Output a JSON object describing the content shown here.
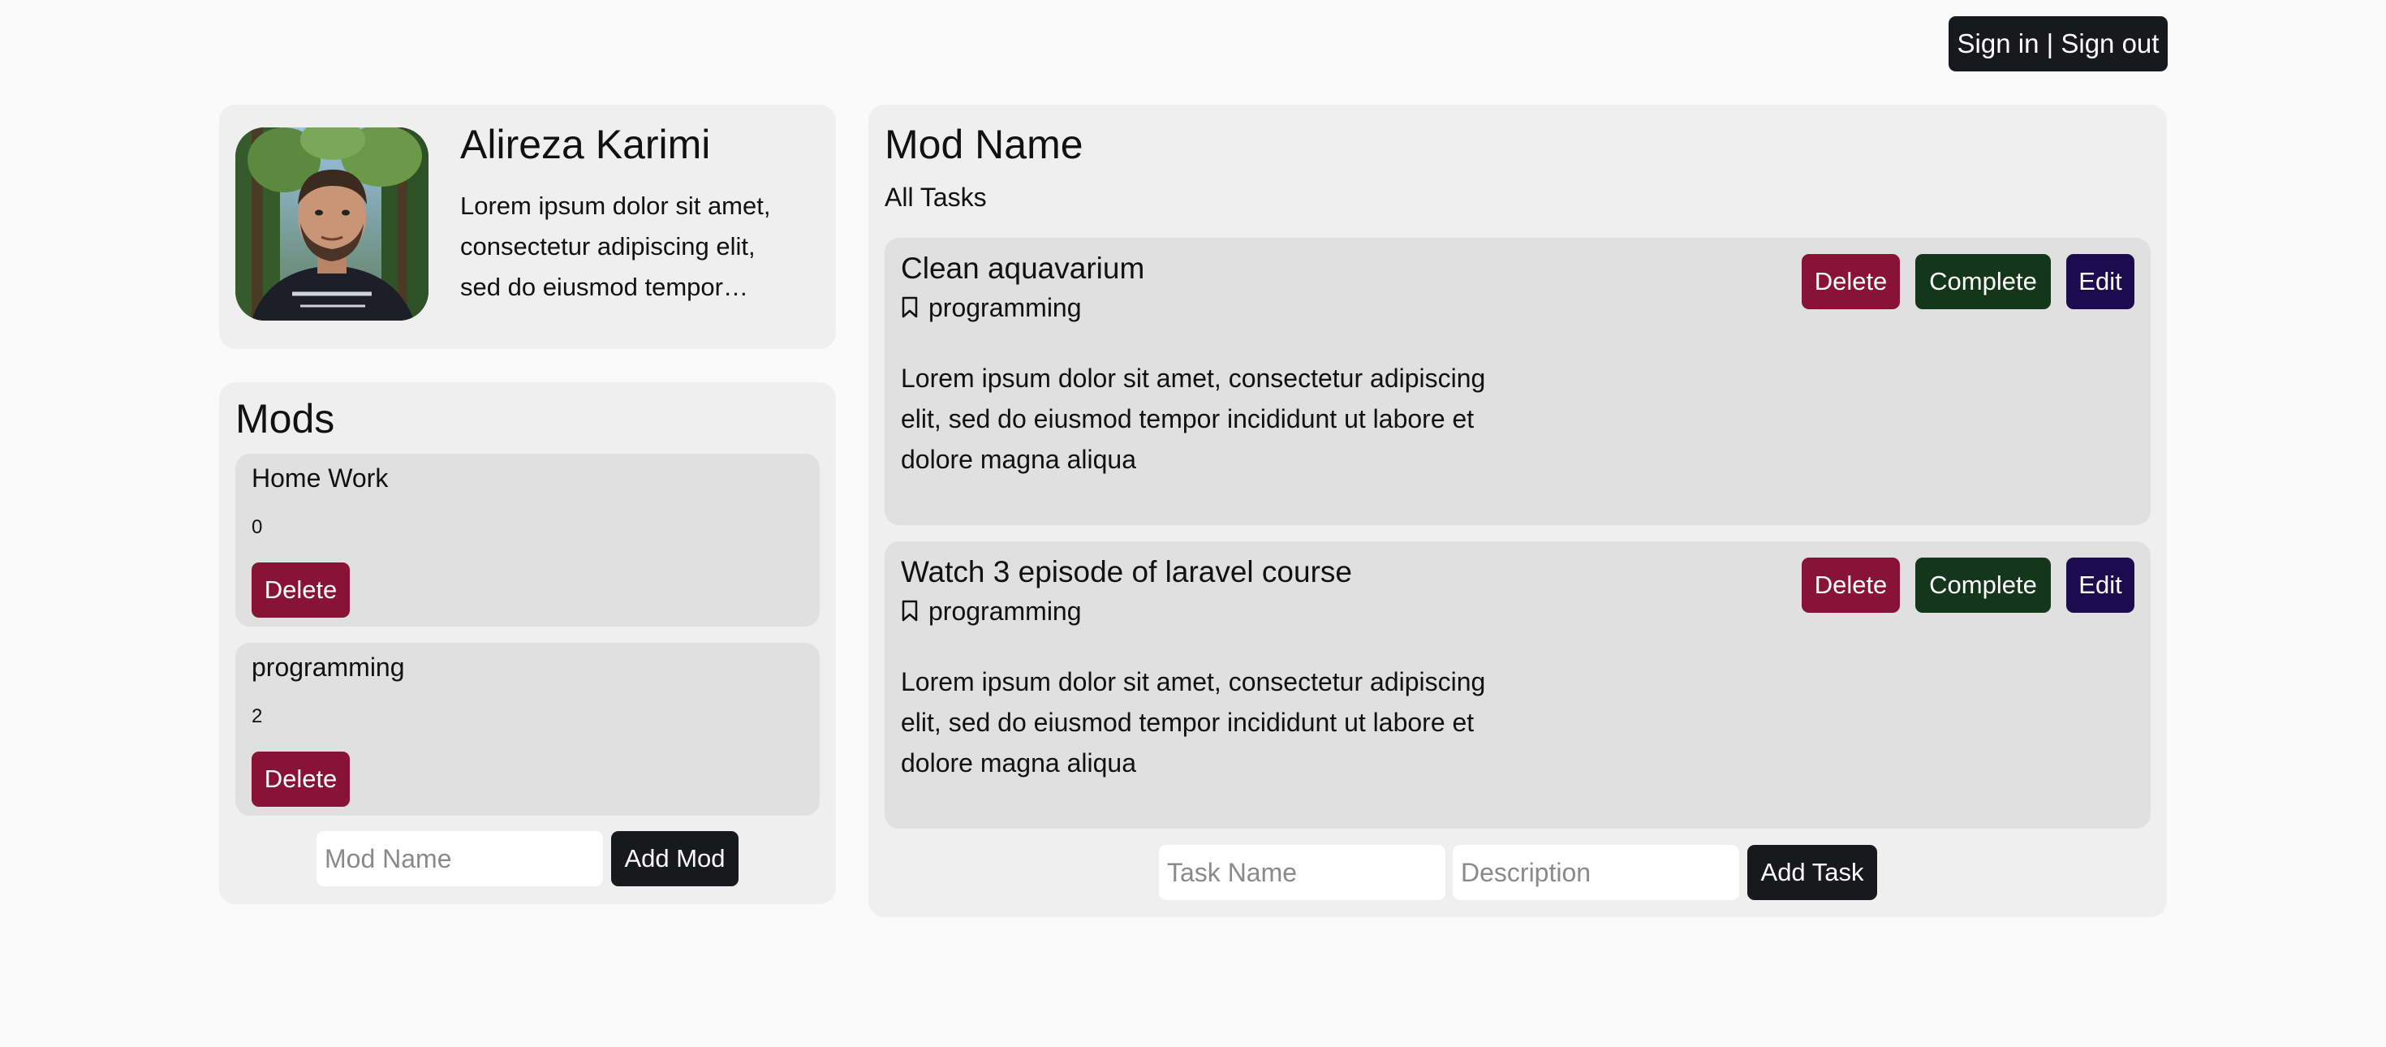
{
  "header": {
    "auth_label": "Sign in | Sign out"
  },
  "profile": {
    "name": "Alireza Karimi",
    "bio": "Lorem ipsum dolor sit amet, consectetur adipiscing elit, sed do eiusmod tempor…"
  },
  "mods": {
    "title": "Mods",
    "items": [
      {
        "name": "Home Work",
        "count": "0",
        "delete_label": "Delete"
      },
      {
        "name": "programming",
        "count": "2",
        "delete_label": "Delete"
      }
    ],
    "input_placeholder": "Mod Name",
    "add_label": "Add Mod"
  },
  "tasks": {
    "title": "Mod Name",
    "subtitle": "All Tasks",
    "items": [
      {
        "name": "Clean aquavarium",
        "tag": "programming",
        "description": "Lorem ipsum dolor sit amet, consectetur adipiscing elit, sed do eiusmod tempor incididunt ut labore et dolore magna aliqua",
        "delete_label": "Delete",
        "complete_label": "Complete",
        "edit_label": "Edit"
      },
      {
        "name": "Watch 3 episode of laravel course",
        "tag": "programming",
        "description": "Lorem ipsum dolor sit amet, consectetur adipiscing elit, sed do eiusmod tempor incididunt ut labore et dolore magna aliqua",
        "delete_label": "Delete",
        "complete_label": "Complete",
        "edit_label": "Edit"
      }
    ],
    "name_placeholder": "Task Name",
    "description_placeholder": "Description",
    "add_label": "Add Task"
  },
  "colors": {
    "delete": "#881337",
    "complete": "#14361a",
    "edit": "#1c0b4f",
    "dark_button": "#18191c",
    "card_bg": "#efefef",
    "item_bg": "#e0e0e0",
    "page_bg": "#fafafa"
  },
  "icons": {
    "tag": "bookmark-icon",
    "avatar": "profile-photo"
  }
}
